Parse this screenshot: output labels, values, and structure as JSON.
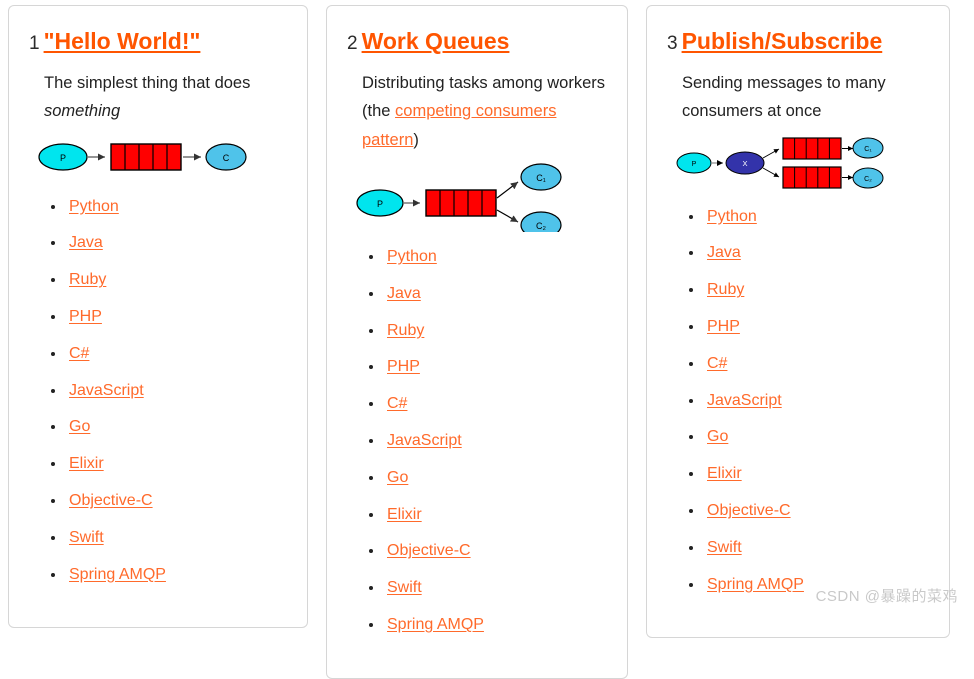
{
  "page": {
    "watermark": "CSDN @暴躁的菜鸡",
    "accent_link_color": "#ff6a2b",
    "heading_link_color": "#ff5500",
    "text_color": "#222222",
    "card_border_color": "#d6d6d6",
    "diagram_colors": {
      "producer_fill": "#00e5ee",
      "consumer_fill": "#4fc3ea",
      "exchange_fill": "#3333aa",
      "queue_fill": "#ff0000",
      "stroke": "#000000",
      "arrow": "#555555"
    }
  },
  "cards": [
    {
      "number": "1",
      "title": "\"Hello World!\"",
      "description_parts": [
        {
          "text": "The simplest thing that does ",
          "style": "plain"
        },
        {
          "text": "something",
          "style": "italic"
        }
      ],
      "diagram": {
        "type": "hello-world",
        "nodes": [
          {
            "id": "producer",
            "label": "P",
            "shape": "ellipse",
            "role": "producer"
          },
          {
            "id": "queue",
            "label": "",
            "shape": "queue",
            "role": "queue",
            "cells": 5
          },
          {
            "id": "consumer",
            "label": "C",
            "shape": "ellipse",
            "role": "consumer"
          }
        ],
        "edges": [
          {
            "from": "producer",
            "to": "queue"
          },
          {
            "from": "queue",
            "to": "consumer"
          }
        ]
      },
      "languages": [
        "Python",
        "Java",
        "Ruby",
        "PHP",
        "C#",
        "JavaScript",
        "Go",
        "Elixir",
        "Objective-C",
        "Swift",
        "Spring AMQP"
      ]
    },
    {
      "number": "2",
      "title": "Work Queues",
      "description_parts": [
        {
          "text": "Distributing tasks among workers (the ",
          "style": "plain"
        },
        {
          "text": "competing consumers pattern",
          "style": "link"
        },
        {
          "text": ")",
          "style": "plain"
        }
      ],
      "diagram": {
        "type": "work-queues",
        "nodes": [
          {
            "id": "producer",
            "label": "P",
            "shape": "ellipse",
            "role": "producer"
          },
          {
            "id": "queue",
            "label": "",
            "shape": "queue",
            "role": "queue",
            "cells": 5
          },
          {
            "id": "consumer1",
            "label": "C₁",
            "shape": "ellipse",
            "role": "consumer"
          },
          {
            "id": "consumer2",
            "label": "C₂",
            "shape": "ellipse",
            "role": "consumer"
          }
        ],
        "edges": [
          {
            "from": "producer",
            "to": "queue"
          },
          {
            "from": "queue",
            "to": "consumer1"
          },
          {
            "from": "queue",
            "to": "consumer2"
          }
        ]
      },
      "languages": [
        "Python",
        "Java",
        "Ruby",
        "PHP",
        "C#",
        "JavaScript",
        "Go",
        "Elixir",
        "Objective-C",
        "Swift",
        "Spring AMQP"
      ]
    },
    {
      "number": "3",
      "title": "Publish/Subscribe",
      "description_parts": [
        {
          "text": "Sending messages to many consumers at once",
          "style": "plain"
        }
      ],
      "diagram": {
        "type": "publish-subscribe",
        "nodes": [
          {
            "id": "producer",
            "label": "P",
            "shape": "ellipse",
            "role": "producer"
          },
          {
            "id": "exchange",
            "label": "X",
            "shape": "ellipse",
            "role": "exchange"
          },
          {
            "id": "queue1",
            "label": "",
            "shape": "queue",
            "role": "queue",
            "cells": 5
          },
          {
            "id": "queue2",
            "label": "",
            "shape": "queue",
            "role": "queue",
            "cells": 5
          },
          {
            "id": "consumer1",
            "label": "C₁",
            "shape": "ellipse",
            "role": "consumer"
          },
          {
            "id": "consumer2",
            "label": "C₂",
            "shape": "ellipse",
            "role": "consumer"
          }
        ],
        "edges": [
          {
            "from": "producer",
            "to": "exchange"
          },
          {
            "from": "exchange",
            "to": "queue1"
          },
          {
            "from": "exchange",
            "to": "queue2"
          },
          {
            "from": "queue1",
            "to": "consumer1"
          },
          {
            "from": "queue2",
            "to": "consumer2"
          }
        ]
      },
      "languages": [
        "Python",
        "Java",
        "Ruby",
        "PHP",
        "C#",
        "JavaScript",
        "Go",
        "Elixir",
        "Objective-C",
        "Swift",
        "Spring AMQP"
      ]
    }
  ]
}
